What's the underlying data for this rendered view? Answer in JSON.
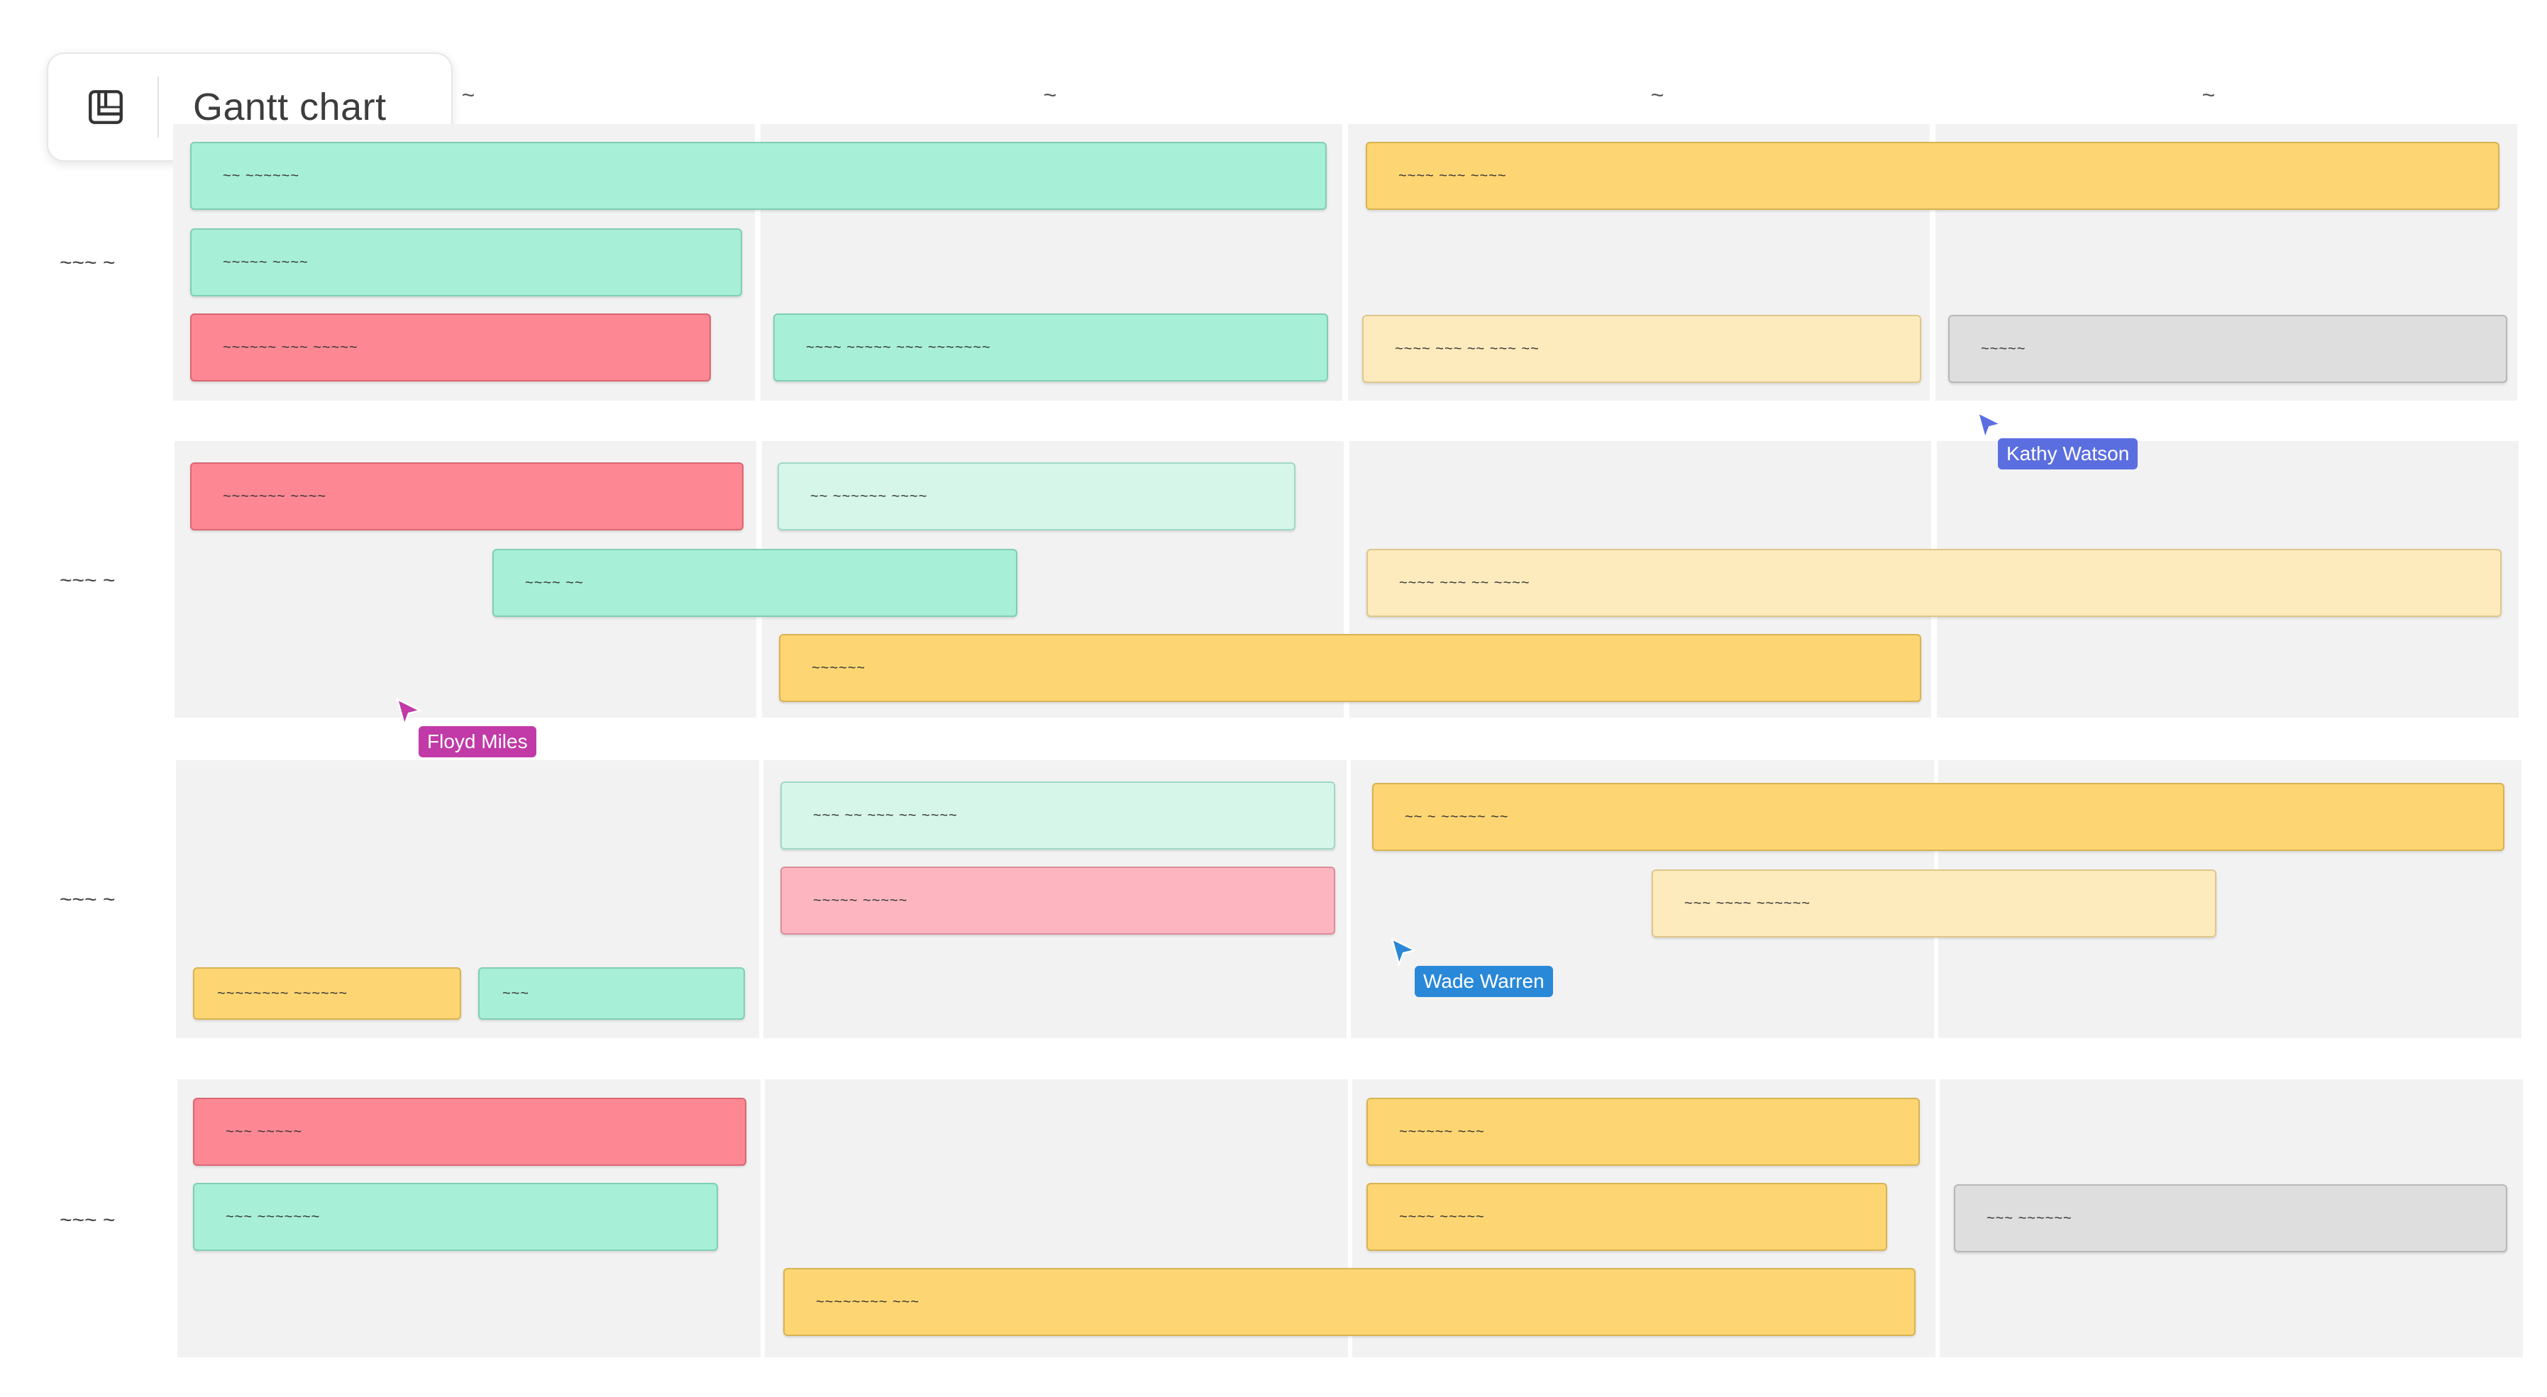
{
  "app": {
    "title": "Gantt chart"
  },
  "icons": {
    "badge_icon": "gantt-icon",
    "cursor_icon": "pointer-arrow-icon"
  },
  "colors": {
    "mint": "#a8efd7",
    "mint_light": "#d7f6ea",
    "yellow": "#fdd673",
    "yellow_light": "#feebbd",
    "red": "#fd8894",
    "pink": "#fdb6bf",
    "gray": "#dedede",
    "cell_background": "#f2f2f2"
  },
  "columns": [
    {
      "label": "~"
    },
    {
      "label": "~"
    },
    {
      "label": "~"
    },
    {
      "label": "~"
    }
  ],
  "rows": [
    {
      "label": "~~~ ~"
    },
    {
      "label": "~~~ ~"
    },
    {
      "label": "~~~ ~"
    },
    {
      "label": "~~~ ~"
    }
  ],
  "tasks": [
    {
      "label": "~~ ~~~~~~"
    },
    {
      "label": "~~~~~ ~~~~"
    },
    {
      "label": "~~~~~~ ~~~ ~~~~~"
    },
    {
      "label": "~~~~ ~~~ ~~~~"
    },
    {
      "label": "~~~~ ~~~~~ ~~~ ~~~~~~~"
    },
    {
      "label": "~~~~ ~~~ ~~ ~~~ ~~"
    },
    {
      "label": "~~~~~"
    },
    {
      "label": "~~~~~~~ ~~~~"
    },
    {
      "label": "~~ ~~~~~~ ~~~~"
    },
    {
      "label": "~~~~ ~~"
    },
    {
      "label": "~~~~ ~~~ ~~ ~~~~"
    },
    {
      "label": "~~~~~~"
    },
    {
      "label": "~~~ ~~ ~~~ ~~ ~~~~"
    },
    {
      "label": "~~ ~ ~~~~~ ~~"
    },
    {
      "label": "~~~~~ ~~~~~"
    },
    {
      "label": "~~~ ~~~~ ~~~~~~"
    },
    {
      "label": "~~~~~~~~ ~~~~~~"
    },
    {
      "label": "~~~"
    },
    {
      "label": "~~~ ~~~~~"
    },
    {
      "label": "~~~~~~ ~~~"
    },
    {
      "label": "~~~ ~~~~~~~"
    },
    {
      "label": "~~~~ ~~~~~"
    },
    {
      "label": "~~~ ~~~~~~"
    },
    {
      "label": "~~~~~~~~ ~~~"
    }
  ],
  "cursors": [
    {
      "name": "Kathy Watson",
      "color": "#5b6ee0"
    },
    {
      "name": "Floyd Miles",
      "color": "#c13aa8"
    },
    {
      "name": "Wade Warren",
      "color": "#2a88d8"
    }
  ]
}
